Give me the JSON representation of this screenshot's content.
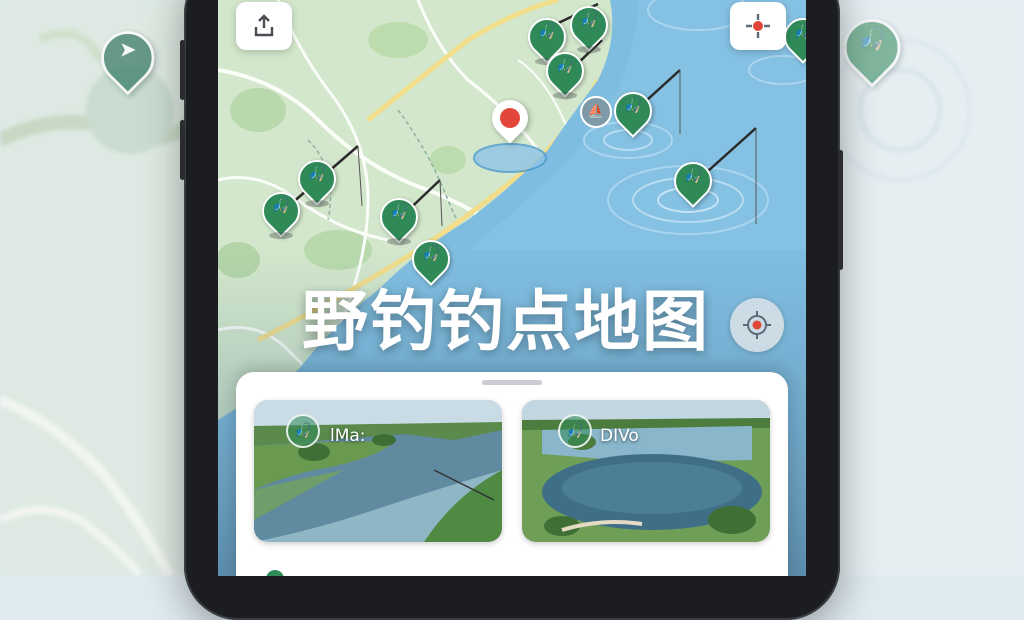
{
  "app": {
    "title": "野钓钓点地图",
    "accent_color": "#2f8a58",
    "water_color": "#7bbbe0",
    "land_color": "#cfe6c8"
  },
  "toolbar": {
    "share_icon": "share-upload-icon",
    "settings_icon": "compass-settings-icon",
    "locate_icon": "locate-target-icon"
  },
  "map": {
    "current_location_icon": "location-pin-icon",
    "marker_icon": "fishing-spot-icon",
    "marker_glyph": "🎣"
  },
  "bottom_sheet": {
    "cards": [
      {
        "label": "lMa:",
        "icon": "fishing-spot-icon"
      },
      {
        "label": "DIVo",
        "icon": "fishing-spot-icon"
      }
    ]
  }
}
